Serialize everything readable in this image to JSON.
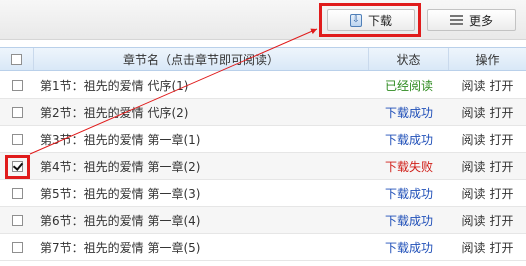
{
  "toolbar": {
    "download_label": "下载",
    "more_label": "更多"
  },
  "table": {
    "headers": {
      "chapter": "章节名（点击章节即可阅读）",
      "status": "状态",
      "ops": "操作"
    },
    "rows": [
      {
        "title": "第1节：祖先的爱情 代序(1)",
        "status": "已经阅读",
        "read": "阅读",
        "open": "打开",
        "checked": false
      },
      {
        "title": "第2节：祖先的爱情 代序(2)",
        "status": "下载成功",
        "read": "阅读",
        "open": "打开",
        "checked": false
      },
      {
        "title": "第3节：祖先的爱情 第一章(1)",
        "status": "下载成功",
        "read": "阅读",
        "open": "打开",
        "checked": false
      },
      {
        "title": "第4节：祖先的爱情 第一章(2)",
        "status": "下载失败",
        "read": "阅读",
        "open": "打开",
        "checked": true
      },
      {
        "title": "第5节：祖先的爱情 第一章(3)",
        "status": "下载成功",
        "read": "阅读",
        "open": "打开",
        "checked": false
      },
      {
        "title": "第6节：祖先的爱情 第一章(4)",
        "status": "下载成功",
        "read": "阅读",
        "open": "打开",
        "checked": false
      },
      {
        "title": "第7节：祖先的爱情 第一章(5)",
        "status": "下载成功",
        "read": "阅读",
        "open": "打开",
        "checked": false
      }
    ]
  },
  "colors": {
    "status_read": "#2e8b20",
    "status_success": "#1f4fb8",
    "status_failed": "#d0201a",
    "highlight": "#e01b1b"
  }
}
